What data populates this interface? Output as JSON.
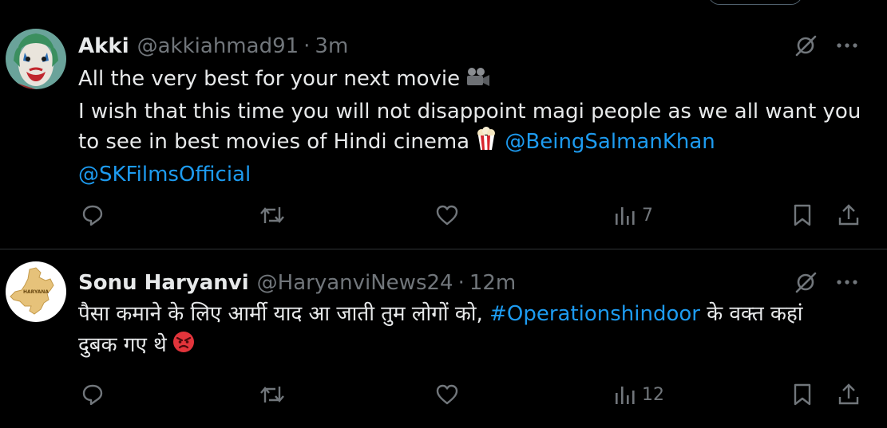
{
  "tweets": [
    {
      "display_name": "Akki",
      "handle": "@akkiahmad91",
      "separator": "·",
      "time": "3m",
      "lines": [
        {
          "text": "All the very best for your next movie",
          "emoji": "movie-camera-icon"
        },
        {
          "text": "I wish that this time you will not disappoint magi people as we all want you"
        },
        {
          "text": "to see in best movies of Hindi cinema",
          "emoji": "popcorn-icon",
          "mention": "@BeingSalmanKhan"
        },
        {
          "mention": "@SKFilmsOfficial"
        }
      ],
      "views": "7",
      "avatar_icon": "joker-avatar-icon"
    },
    {
      "display_name": "Sonu Haryanvi",
      "handle": "@HaryanviNews24",
      "separator": "·",
      "time": "12m",
      "lines": [
        {
          "text": "पैसा कमाने के लिए आर्मी याद आ जाती तुम लोगों को,",
          "hashtag": "#Operationshindoor",
          "text_after": "के वक्त कहां"
        },
        {
          "text": "दुबक गए थे",
          "emoji": "angry-face-icon"
        }
      ],
      "views": "12",
      "avatar_icon": "haryana-map-avatar-icon",
      "avatar_label": "HARYANA"
    }
  ],
  "colors": {
    "background": "#000000",
    "text": "#e7e9ea",
    "secondary": "#71767b",
    "link": "#1d9bf0",
    "divider": "#2f3336"
  }
}
